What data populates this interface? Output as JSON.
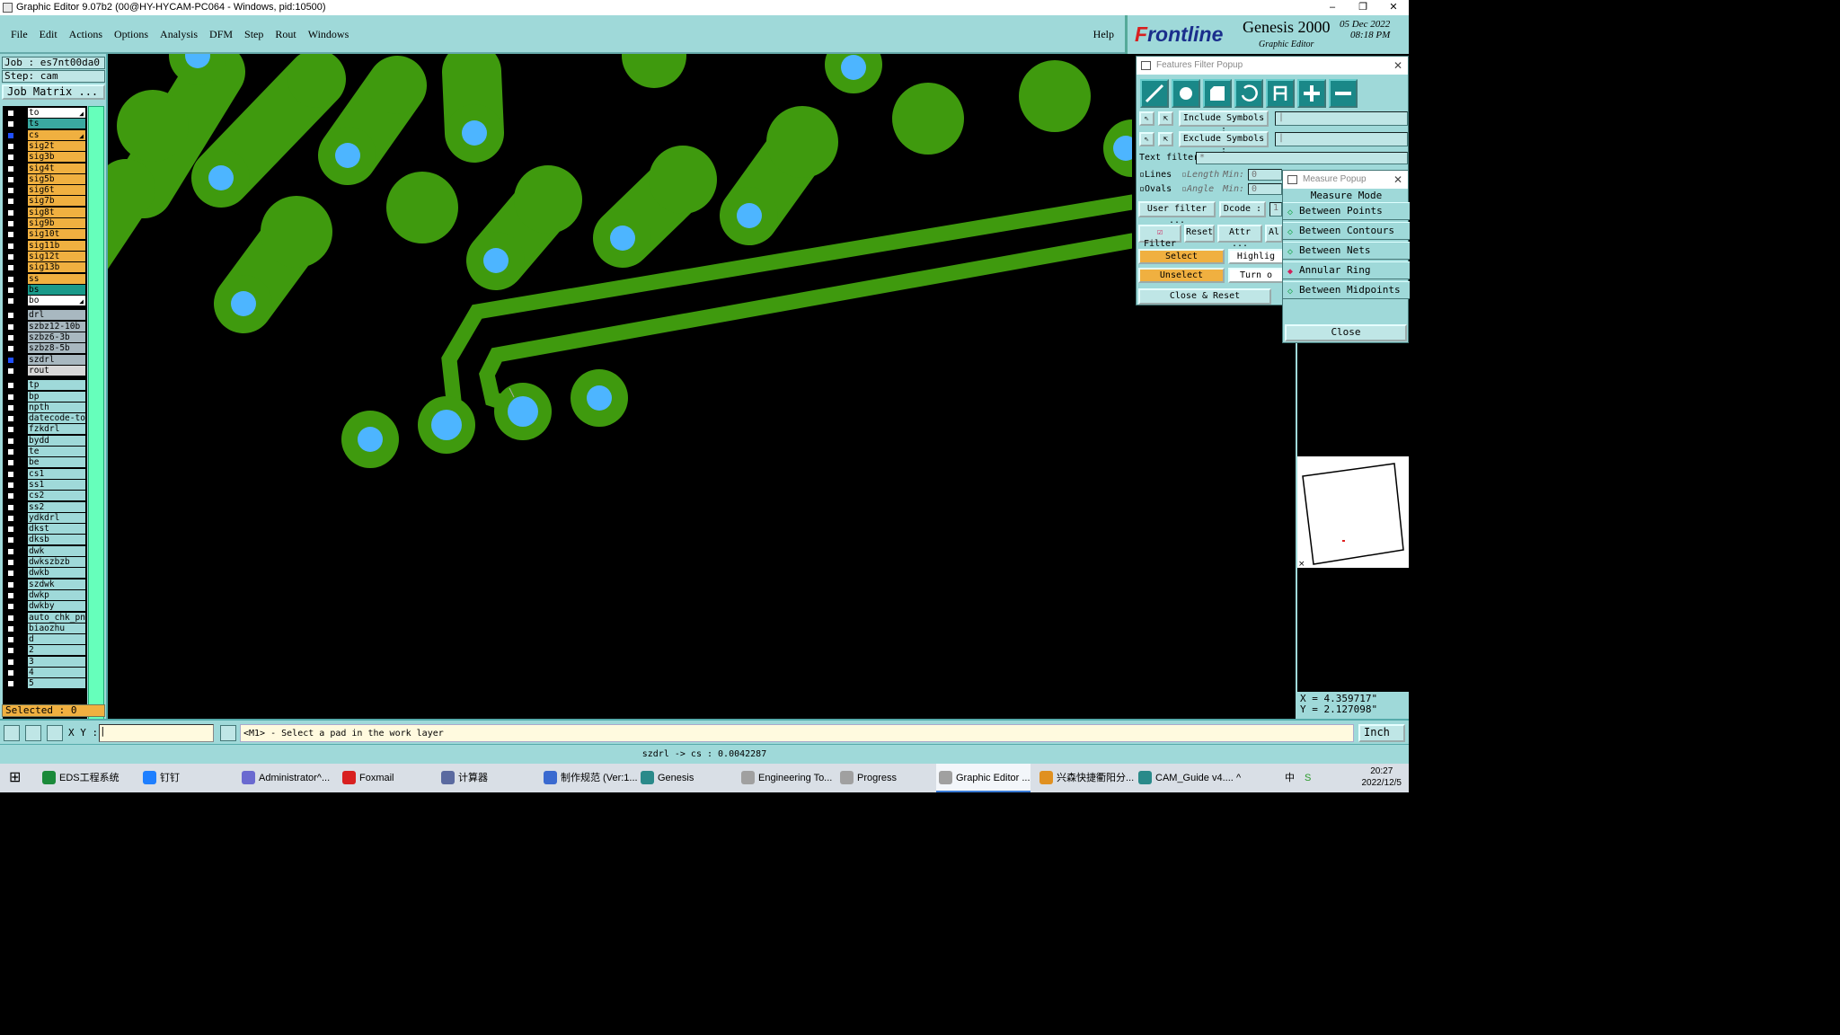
{
  "window": {
    "title": "Graphic Editor 9.07b2 (00@HY-HYCAM-PC064 - Windows, pid:10500)",
    "controls": [
      "–",
      "❐",
      "✕"
    ]
  },
  "menubar": {
    "items": [
      "File",
      "Edit",
      "Actions",
      "Options",
      "Analysis",
      "DFM",
      "Step",
      "Rout",
      "Windows"
    ],
    "help": "Help"
  },
  "brand": {
    "logo_prefix": "F",
    "logo_rest": "rontline",
    "product": "Genesis 2000",
    "subtitle": "Graphic Editor",
    "date": "05 Dec 2022",
    "time": "08:18 PM"
  },
  "left_panel": {
    "job": "Job : es7nt00da0",
    "step": "Step: cam",
    "job_matrix_button": "Job Matrix ...",
    "selected": "Selected : 0",
    "layers": [
      {
        "name": "to",
        "color": "#ffffff",
        "checked": false,
        "arrow": true
      },
      {
        "name": "ts",
        "color": "#3aa8a0",
        "checked": false
      },
      {
        "name": "cs",
        "color": "#f0b040",
        "checked": true,
        "arrow": true
      },
      {
        "name": "sig2t",
        "color": "#f0b040"
      },
      {
        "name": "sig3b",
        "color": "#f0b040"
      },
      {
        "name": "sig4t",
        "color": "#f0b040"
      },
      {
        "name": "sig5b",
        "color": "#f0b040"
      },
      {
        "name": "sig6t",
        "color": "#f0b040"
      },
      {
        "name": "sig7b",
        "color": "#f0b040"
      },
      {
        "name": "sig8t",
        "color": "#f0b040"
      },
      {
        "name": "sig9b",
        "color": "#f0b040"
      },
      {
        "name": "sig10t",
        "color": "#f0b040"
      },
      {
        "name": "sig11b",
        "color": "#f0b040"
      },
      {
        "name": "sig12t",
        "color": "#f0b040"
      },
      {
        "name": "sig13b",
        "color": "#f0b040"
      },
      {
        "name": "ss",
        "color": "#f0b040"
      },
      {
        "name": "bs",
        "color": "#1a9a8a"
      },
      {
        "name": "bo",
        "color": "#ffffff",
        "arrow": true
      },
      {
        "name": "drl",
        "color": "#a8b8c0"
      },
      {
        "name": "szbz12-10b",
        "color": "#a8b8c0"
      },
      {
        "name": "szbz6-3b",
        "color": "#a8b8c0"
      },
      {
        "name": "szbz8-5b",
        "color": "#a8b8c0"
      },
      {
        "name": "szdrl",
        "color": "#a8b8c0",
        "checked": true
      },
      {
        "name": "rout",
        "color": "#d8d8d8"
      },
      {
        "name": "tp",
        "color": "#9fd9d9"
      },
      {
        "name": "bp",
        "color": "#9fd9d9"
      },
      {
        "name": "npth",
        "color": "#9fd9d9"
      },
      {
        "name": "datecode-to",
        "color": "#9fd9d9"
      },
      {
        "name": "fzkdrl",
        "color": "#9fd9d9"
      },
      {
        "name": "bydd",
        "color": "#9fd9d9"
      },
      {
        "name": "te",
        "color": "#9fd9d9"
      },
      {
        "name": "be",
        "color": "#9fd9d9"
      },
      {
        "name": "cs1",
        "color": "#9fd9d9"
      },
      {
        "name": "ss1",
        "color": "#9fd9d9"
      },
      {
        "name": "cs2",
        "color": "#9fd9d9"
      },
      {
        "name": "ss2",
        "color": "#9fd9d9"
      },
      {
        "name": "ydkdrl",
        "color": "#9fd9d9"
      },
      {
        "name": "dkst",
        "color": "#9fd9d9"
      },
      {
        "name": "dksb",
        "color": "#9fd9d9"
      },
      {
        "name": "dwk",
        "color": "#9fd9d9"
      },
      {
        "name": "dwkszbzb",
        "color": "#9fd9d9"
      },
      {
        "name": "dwkb",
        "color": "#9fd9d9"
      },
      {
        "name": "szdwk",
        "color": "#9fd9d9"
      },
      {
        "name": "dwkp",
        "color": "#9fd9d9"
      },
      {
        "name": "dwkby",
        "color": "#9fd9d9"
      },
      {
        "name": "auto_chk_pn",
        "color": "#9fd9d9"
      },
      {
        "name": "biaozhu",
        "color": "#9fd9d9"
      },
      {
        "name": "d",
        "color": "#9fd9d9"
      },
      {
        "name": "2",
        "color": "#9fd9d9"
      },
      {
        "name": "3",
        "color": "#9fd9d9"
      },
      {
        "name": "4",
        "color": "#9fd9d9"
      },
      {
        "name": "5",
        "color": "#9fd9d9"
      }
    ]
  },
  "features_filter": {
    "title": "Features Filter Popup",
    "close": "✕",
    "include_label": "Include Symbols :",
    "include_value": "|",
    "exclude_label": "Exclude Symbols :",
    "exclude_value": "|",
    "text_filter_label": "Text filter",
    "text_filter_value": "*",
    "lines": "Lines",
    "ovals": "Ovals",
    "length": "Length",
    "angle": "Angle",
    "min1": "Min:",
    "min2": "Min:",
    "min1_value": "0",
    "min2_value": "0",
    "user_filter": "User filter ...",
    "dcode": "Dcode :",
    "dcode_value": "1",
    "filter": "Filter",
    "reset": "Reset",
    "attr": "Attr ...",
    "al": "Al",
    "select": "Select",
    "highlight": "Highlig",
    "unselect": "Unselect",
    "turn": "Turn o",
    "close_reset": "Close & Reset"
  },
  "measure": {
    "title": "Measure Popup",
    "close": "✕",
    "header": "Measure Mode",
    "modes": [
      {
        "label": "Between Points",
        "active": false
      },
      {
        "label": "Between Contours",
        "active": false
      },
      {
        "label": "Between Nets",
        "active": false
      },
      {
        "label": "Annular Ring",
        "active": true
      },
      {
        "label": "Between Midpoints",
        "active": false
      }
    ],
    "close_button": "Close"
  },
  "coords": {
    "x": "X = 4.359717\"",
    "y": "Y = 2.127098\""
  },
  "bottombar": {
    "xy_label": "X Y :",
    "xy_value": "|",
    "prompt": "<M1> - Select a pad in the work layer",
    "unit": "Inch"
  },
  "status": {
    "text": "szdrl -> cs : 0.0042287"
  },
  "colors": {
    "copper": "#3f9a0e",
    "drill": "#4db5ff",
    "canvas": "#000000",
    "panel": "#9fd9d9"
  },
  "taskbar": {
    "items": [
      {
        "label": "EDS工程系统",
        "icon_color": "#1a8a3a"
      },
      {
        "label": "钉钉",
        "icon_color": "#1e7fff"
      },
      {
        "label": "Administrator^...",
        "icon_color": "#6a6ad0"
      },
      {
        "label": "Foxmail",
        "icon_color": "#d82020"
      },
      {
        "label": "计算器",
        "icon_color": "#5a6aa0"
      },
      {
        "label": "制作规范 (Ver:1...",
        "icon_color": "#3a6ad0"
      },
      {
        "label": "Genesis",
        "icon_color": "#2a8a8a"
      },
      {
        "label": "Engineering To...",
        "icon_color": "#a0a0a0"
      },
      {
        "label": "Progress",
        "icon_color": "#a0a0a0"
      },
      {
        "label": "Graphic Editor ...",
        "icon_color": "#a0a0a0",
        "active": true
      },
      {
        "label": "兴森快捷衢阳分...",
        "icon_color": "#e09020"
      },
      {
        "label": "CAM_Guide v4....",
        "icon_color": "#2a8a8a"
      }
    ],
    "tray": [
      "^",
      "中",
      "S"
    ],
    "time": "20:27",
    "date": "2022/12/5"
  }
}
